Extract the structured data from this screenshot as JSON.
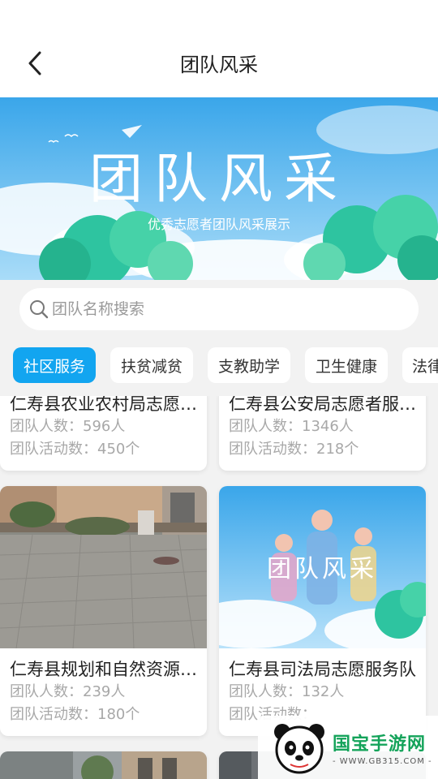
{
  "header": {
    "title": "团队风采"
  },
  "banner": {
    "title": "团队风采",
    "subtitle": "优秀志愿者团队风采展示"
  },
  "search": {
    "placeholder": "团队名称搜索"
  },
  "tabs": [
    {
      "label": "社区服务",
      "active": true
    },
    {
      "label": "扶贫减贫",
      "active": false
    },
    {
      "label": "支教助学",
      "active": false
    },
    {
      "label": "卫生健康",
      "active": false
    },
    {
      "label": "法律",
      "active": false
    }
  ],
  "cards": [
    {
      "title": "仁寿县农业农村局志愿者服务队",
      "members": "团队人数：596人",
      "activities": "团队活动数：450个"
    },
    {
      "title": "仁寿县公安局志愿者服务队",
      "members": "团队人数：1346人",
      "activities": "团队活动数：218个"
    },
    {
      "title": "仁寿县规划和自然资源局志愿服务队",
      "members": "团队人数：239人",
      "activities": "团队活动数：180个"
    },
    {
      "title": "仁寿县司法局志愿服务队",
      "members": "团队人数：132人",
      "activities": "团队活动数："
    },
    {
      "title": "",
      "members": "",
      "activities": ""
    },
    {
      "title": "",
      "members": "",
      "activities": ""
    }
  ],
  "card_images": [
    {
      "kind": "courtyard-photo"
    },
    {
      "kind": "team-style-poster",
      "poster_title": "团队风采"
    }
  ],
  "watermark": {
    "brand": "国宝手游网",
    "url": "- WWW.GB315.COM -"
  },
  "colors": {
    "accent": "#12a5f0",
    "title_text": "#222222",
    "muted_text": "#a8a8a8",
    "background": "#f2f2f2",
    "brand_green": "#14a35a"
  }
}
